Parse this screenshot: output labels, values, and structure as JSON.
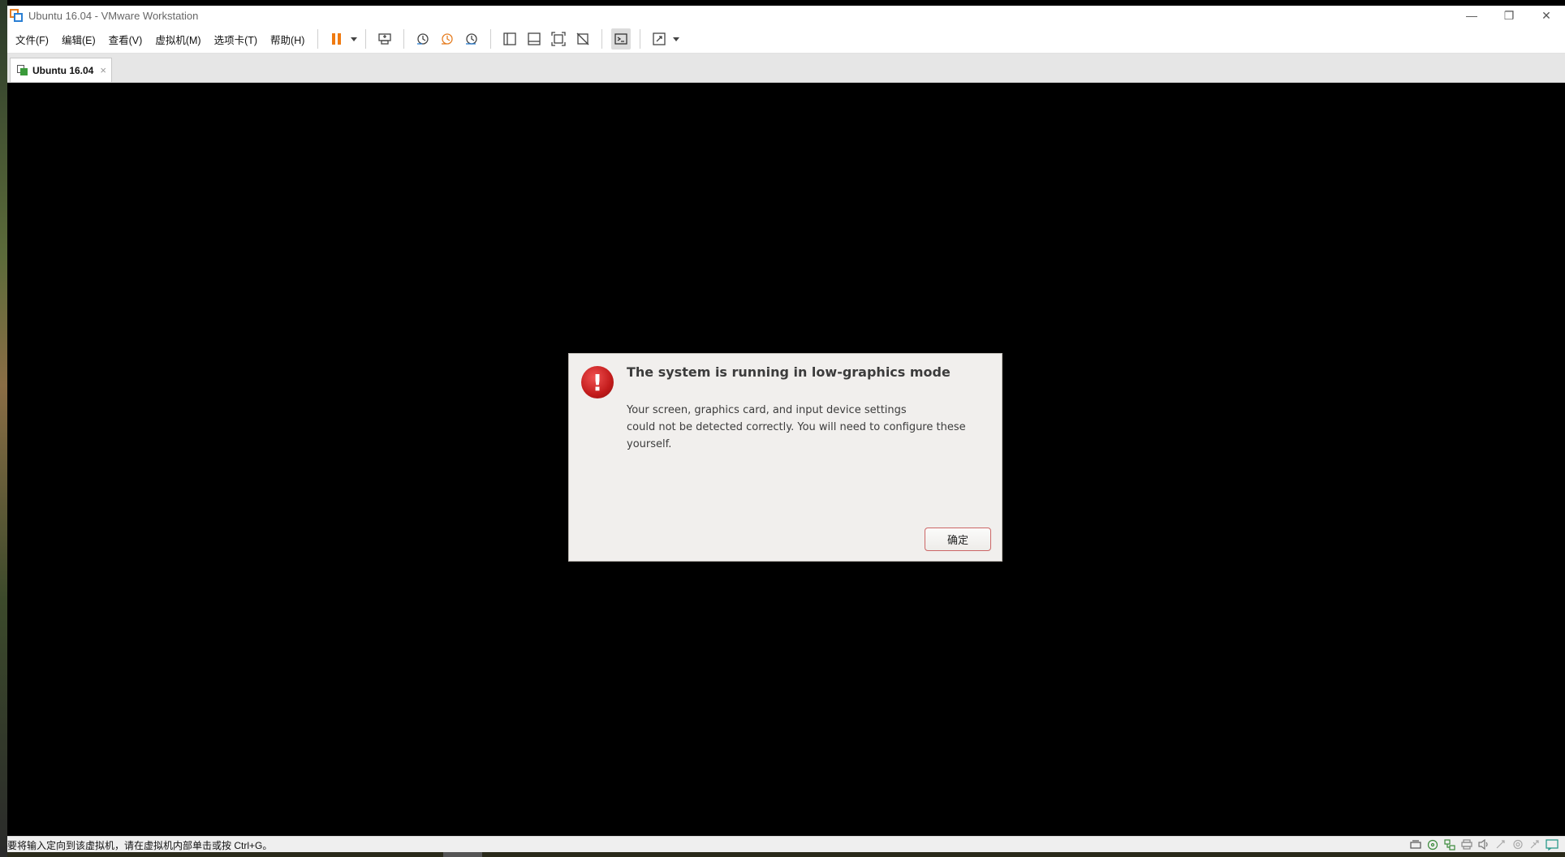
{
  "window": {
    "title": "Ubuntu 16.04 - VMware Workstation",
    "controls": {
      "minimize": "—",
      "restore": "❐",
      "close": "✕"
    }
  },
  "menu": {
    "items": [
      "文件(F)",
      "编辑(E)",
      "查看(V)",
      "虚拟机(M)",
      "选项卡(T)",
      "帮助(H)"
    ]
  },
  "toolbar": {
    "icons": [
      "pause-icon",
      "send-keys-icon",
      "snapshot-icon",
      "revert-snapshot-icon",
      "snapshot-manager-icon",
      "library-icon",
      "thumbnail-bar-icon",
      "fit-guest-icon",
      "fullscreen-off-icon",
      "console-view-icon",
      "stretch-icon"
    ]
  },
  "tab": {
    "label": "Ubuntu 16.04",
    "close": "×"
  },
  "dialog": {
    "title": "The system is running in low-graphics mode",
    "line1": "Your screen, graphics card, and input device settings",
    "line2": "could not be detected correctly.  You will need to configure these yourself.",
    "ok_label": "确定",
    "icon_glyph": "!"
  },
  "statusbar": {
    "text": "要将输入定向到该虚拟机，请在虚拟机内部单击或按 Ctrl+G。",
    "icons": [
      "hard-disk-icon",
      "cd-dvd-icon",
      "network-icon",
      "printer-icon",
      "sound-icon",
      "usb-icon",
      "camera-icon",
      "usb2-icon",
      "message-icon"
    ]
  },
  "colors": {
    "accent_orange": "#e67e22",
    "dialog_bg": "#f1efed",
    "error_red": "#c21b1b",
    "vm_bg": "#000000"
  }
}
